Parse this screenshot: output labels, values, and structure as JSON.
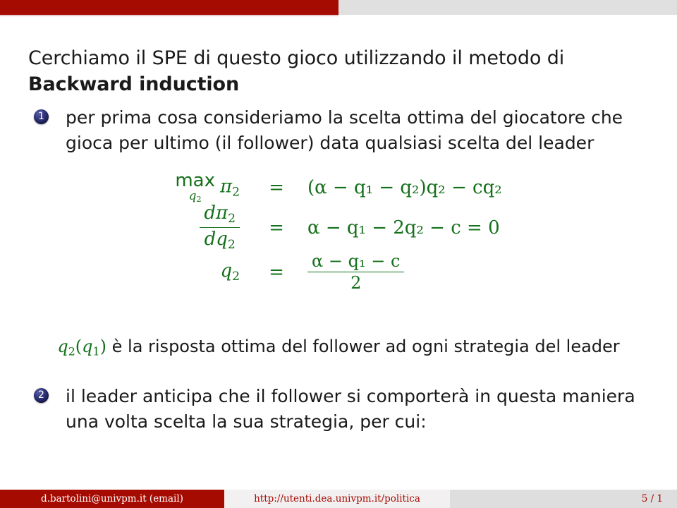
{
  "topbar": {
    "progress_percent": 50,
    "fill_color": "#a60b02",
    "track_color": "#e0e0e0"
  },
  "slide": {
    "title_plain": "Cerchiamo il SPE di questo gioco utilizzando il metodo di Backward induction",
    "title_lead": "Cerchiamo il SPE di questo gioco utilizzando il metodo di ",
    "title_bold": "Backward induction",
    "items": [
      {
        "marker": "1",
        "text": "per prima cosa consideriamo la scelta ottima del giocatore che gioca per ultimo (il follower) data qualsiasi scelta del leader"
      },
      {
        "marker": "2",
        "text": "il leader anticipa che il follower si comporterà in questa maniera una volta scelta la sua strategia, per cui:"
      }
    ],
    "math": {
      "color": "#14701a",
      "rows": [
        {
          "lhs_main": "max",
          "lhs_sub": "q",
          "lhs_sub_idx": "2",
          "lhs_var": "π",
          "lhs_var_idx": "2",
          "relation": "=",
          "rhs": "(α − q₁ − q₂)q₂ − cq₂"
        },
        {
          "lhs_num_d": "d",
          "lhs_num_var": "π",
          "lhs_num_idx": "2",
          "lhs_den_d": "d",
          "lhs_den_var": "q",
          "lhs_den_idx": "2",
          "relation": "=",
          "rhs": "α − q₁ − 2q₂ − c = 0"
        },
        {
          "lhs_var": "q",
          "lhs_idx": "2",
          "relation": "=",
          "rhs_num": "α − q₁ − c",
          "rhs_den": "2"
        }
      ],
      "symbols": {
        "alpha": "α",
        "pi": "π",
        "minus": "−",
        "equals": "=",
        "q": "q",
        "c": "c",
        "d": "d",
        "max": "max",
        "two": "2",
        "zero": "0",
        "sub1": "1",
        "sub2": "2"
      }
    },
    "annotation": {
      "math_prefix_var": "q",
      "math_prefix_sub": "2",
      "math_arg_open": "(",
      "math_arg_var": "q",
      "math_arg_sub": "1",
      "math_arg_close": ")",
      "text": "è la risposta ottima del follower ad ogni strategia del leader"
    }
  },
  "footer": {
    "author": "d.bartolini@univpm.it  (email)",
    "url": "http://utenti.dea.univpm.it/politica",
    "page": "5 / 1",
    "author_bg": "#a60b02",
    "url_bg": "#f2f0f0",
    "page_bg": "#dedede",
    "accent": "#a60b02"
  }
}
